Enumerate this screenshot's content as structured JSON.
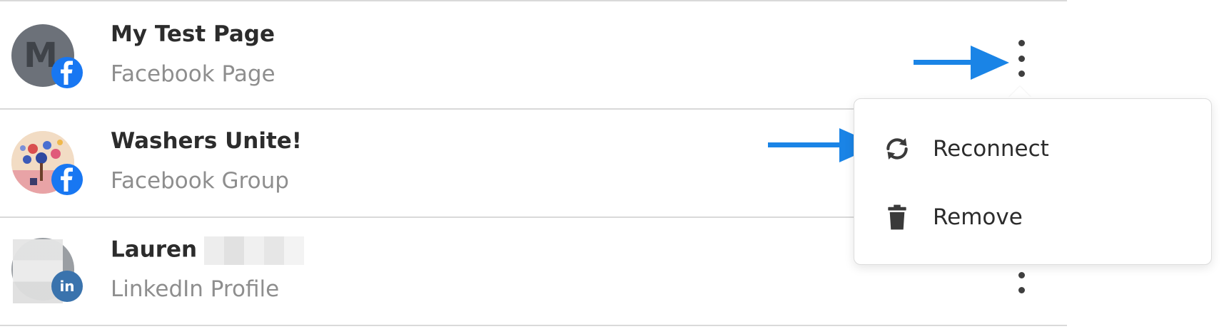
{
  "accounts": [
    {
      "name": "My Test Page",
      "name_suffix": "",
      "type": "Facebook Page",
      "avatar_letter": "M",
      "network": "facebook"
    },
    {
      "name": "Washers Unite!",
      "name_suffix": "",
      "type": "Facebook Group",
      "avatar_letter": "",
      "network": "facebook"
    },
    {
      "name": "Lauren",
      "name_suffix": "",
      "type": "LinkedIn Profile",
      "avatar_letter": "",
      "network": "linkedin"
    }
  ],
  "badges": {
    "linkedin_text": "in"
  },
  "menu": {
    "items": [
      {
        "label": "Reconnect",
        "icon": "reconnect-icon"
      },
      {
        "label": "Remove",
        "icon": "trash-icon"
      }
    ]
  },
  "colors": {
    "facebook_blue": "#1877f2",
    "linkedin_blue": "#3a73ad",
    "annotation_arrow": "#1a84e6",
    "name_text": "#2c2c2c",
    "sub_text": "#8e8e8e"
  }
}
